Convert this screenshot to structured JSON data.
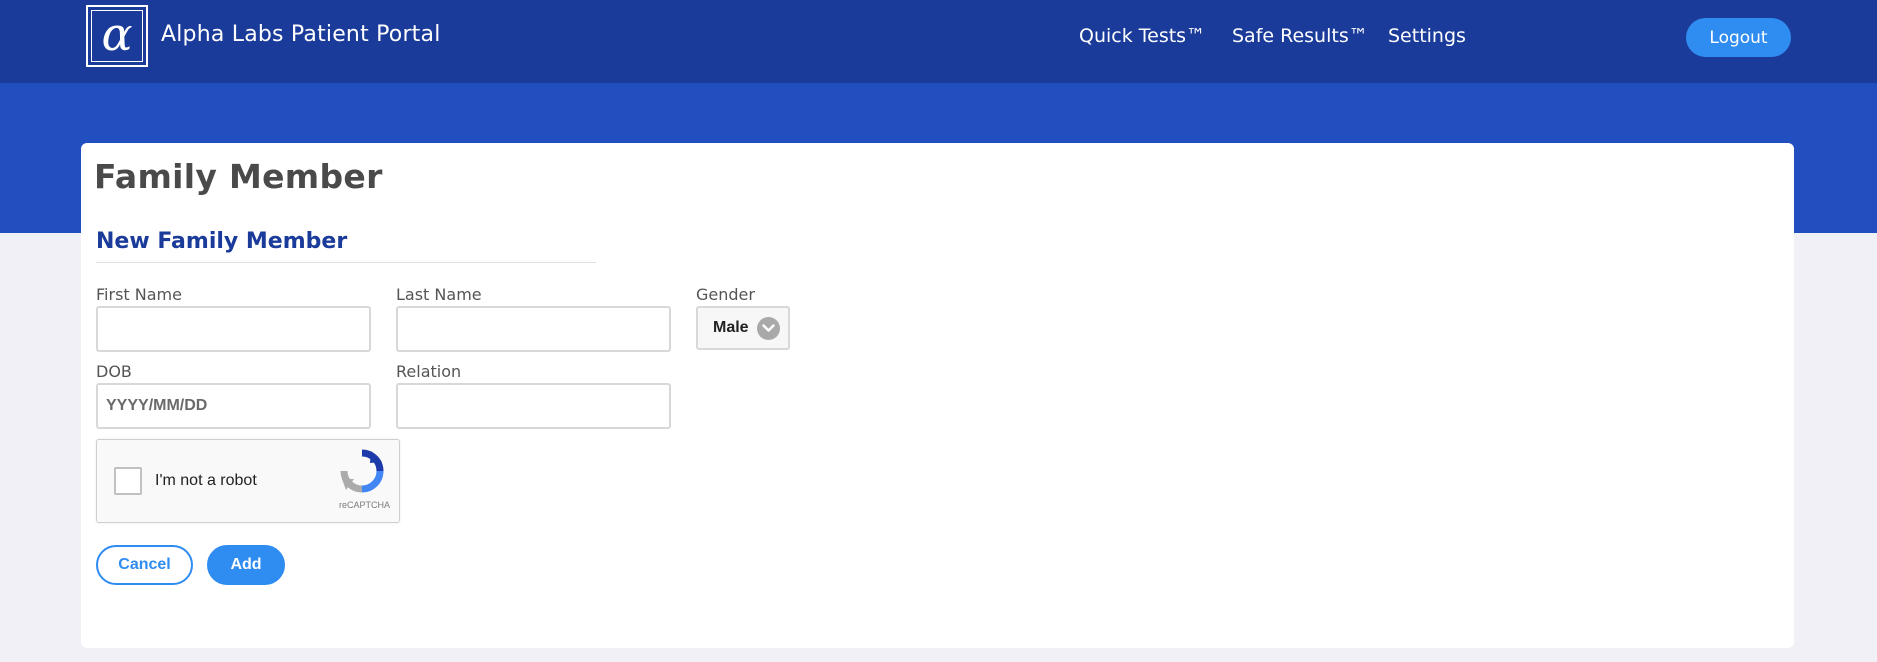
{
  "header": {
    "brand": "Alpha Labs Patient Portal",
    "logo_glyph": "α",
    "nav": {
      "quick_tests": "Quick Tests™",
      "safe_results": "Safe Results™",
      "settings": "Settings"
    },
    "logout_label": "Logout"
  },
  "page": {
    "title": "Family Member",
    "section_title": "New Family Member"
  },
  "form": {
    "first_name": {
      "label": "First Name",
      "value": ""
    },
    "last_name": {
      "label": "Last Name",
      "value": ""
    },
    "gender": {
      "label": "Gender",
      "selected": "Male"
    },
    "dob": {
      "label": "DOB",
      "value": "",
      "placeholder": "YYYY/MM/DD"
    },
    "relation": {
      "label": "Relation",
      "value": ""
    }
  },
  "captcha": {
    "label": "I'm not a robot",
    "brand": "reCAPTCHA",
    "checked": false
  },
  "actions": {
    "cancel_label": "Cancel",
    "add_label": "Add"
  },
  "colors": {
    "header_bg": "#1a3b9a",
    "band_bg": "#214fbf",
    "accent": "#2f8cf0",
    "section_title": "#1a3b9a",
    "page_bg": "#f0f0f6"
  },
  "icons": {
    "logo": "alpha-logo-icon",
    "select_chevron": "chevron-down-icon",
    "captcha": "recaptcha-icon"
  }
}
